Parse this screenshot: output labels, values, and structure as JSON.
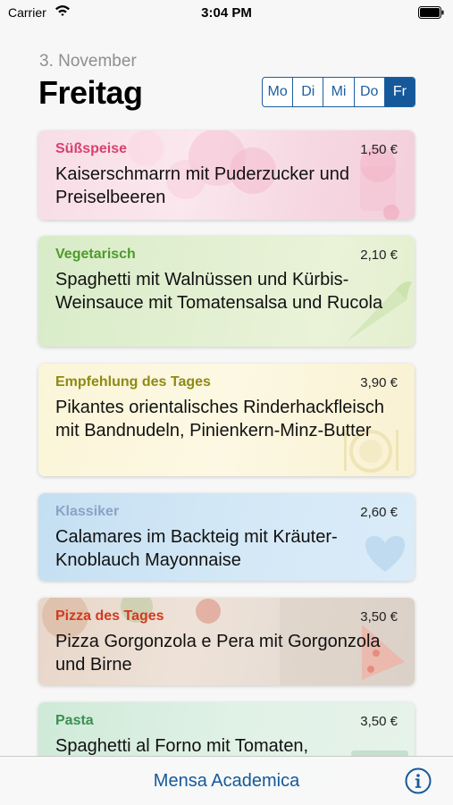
{
  "status_bar": {
    "carrier": "Carrier",
    "time": "3:04 PM"
  },
  "header": {
    "date": "3. November",
    "weekday": "Freitag"
  },
  "day_selector": {
    "days": [
      "Mo",
      "Di",
      "Mi",
      "Do",
      "Fr"
    ],
    "selected": "Fr"
  },
  "menu": [
    {
      "category": "Süßspeise",
      "price": "1,50 €",
      "title": "Kaiserschmarrn mit Puderzucker und Preiselbeeren",
      "category_color": "#d9406f"
    },
    {
      "category": "Vegetarisch",
      "price": "2,10 €",
      "title": "Spaghetti mit Walnüssen und Kürbis-Weinsauce  mit Tomatensalsa und Rucola",
      "category_color": "#4e9a2c"
    },
    {
      "category": "Empfehlung des Tages",
      "price": "3,90 €",
      "title": "Pikantes orientalisches Rinderhackfleisch mit Bandnudeln, Pinienkern-Minz-Butter",
      "category_color": "#8f8a12"
    },
    {
      "category": "Klassiker",
      "price": "2,60 €",
      "title": "Calamares im Backteig mit Kräuter-Knoblauch Mayonnaise",
      "category_color": "#8aa3c6"
    },
    {
      "category": "Pizza des Tages",
      "price": "3,50 €",
      "title": "Pizza Gorgonzola e Pera mit Gorgonzola und Birne",
      "category_color": "#d13a1f"
    },
    {
      "category": "Pasta",
      "price": "3,50 €",
      "title": "Spaghetti al Forno mit Tomaten,",
      "category_color": "#3d8f50"
    }
  ],
  "bottom_bar": {
    "title": "Mensa Academica",
    "info_icon": "info-icon"
  },
  "colors": {
    "accent": "#15599a",
    "background": "#f7f7f7"
  }
}
